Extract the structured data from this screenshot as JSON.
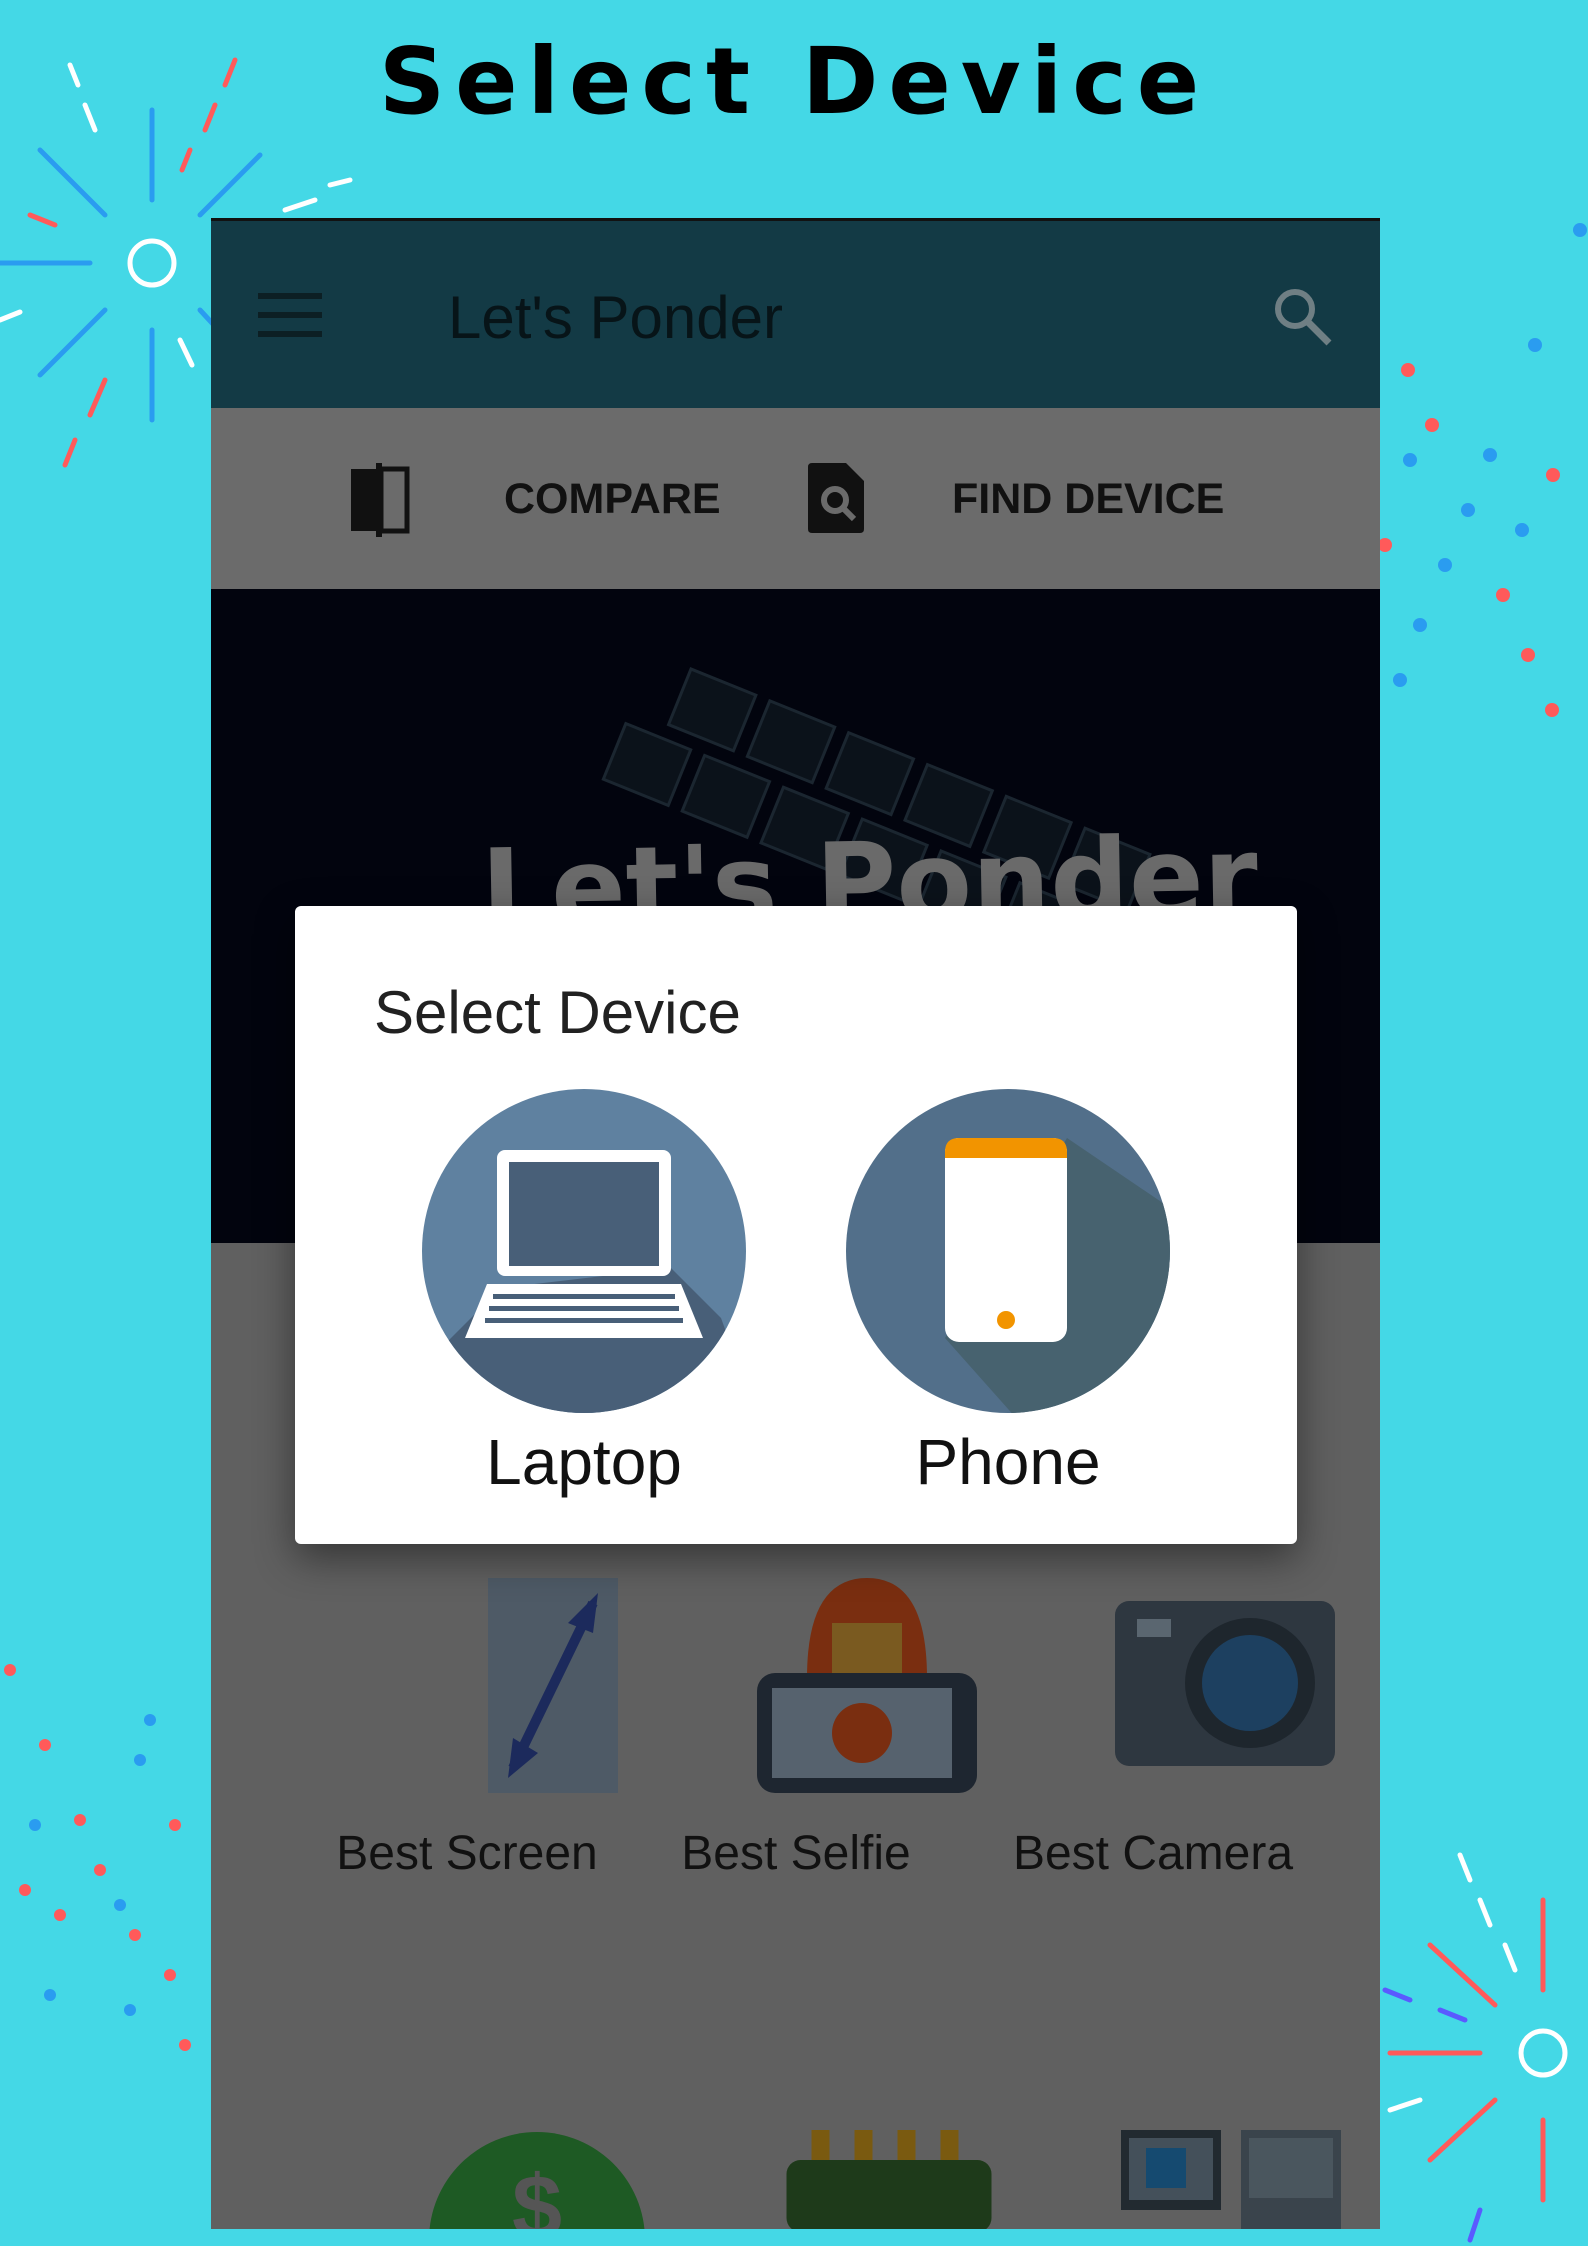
{
  "headline": "Select Device",
  "app": {
    "title": "Let's Ponder",
    "menu_icon": "hamburger-menu-icon",
    "search_icon": "search-icon",
    "bar_color": "#133a45"
  },
  "tabs": [
    {
      "label": "COMPARE",
      "icon": "compare-icon"
    },
    {
      "label": "FIND DEVICE",
      "icon": "find-device-icon"
    }
  ],
  "banner": {
    "text": "Let's Ponder"
  },
  "grid": [
    {
      "label": "Best Screen"
    },
    {
      "label": "Best Selfie"
    },
    {
      "label": "Best Camera"
    }
  ],
  "dialog": {
    "title": "Select Device",
    "options": [
      {
        "label": "Laptop",
        "icon": "laptop-icon"
      },
      {
        "label": "Phone",
        "icon": "phone-icon"
      }
    ]
  },
  "colors": {
    "background": "#44d8e6",
    "accent_orange": "#f29400",
    "circle": "#5f81a0"
  }
}
